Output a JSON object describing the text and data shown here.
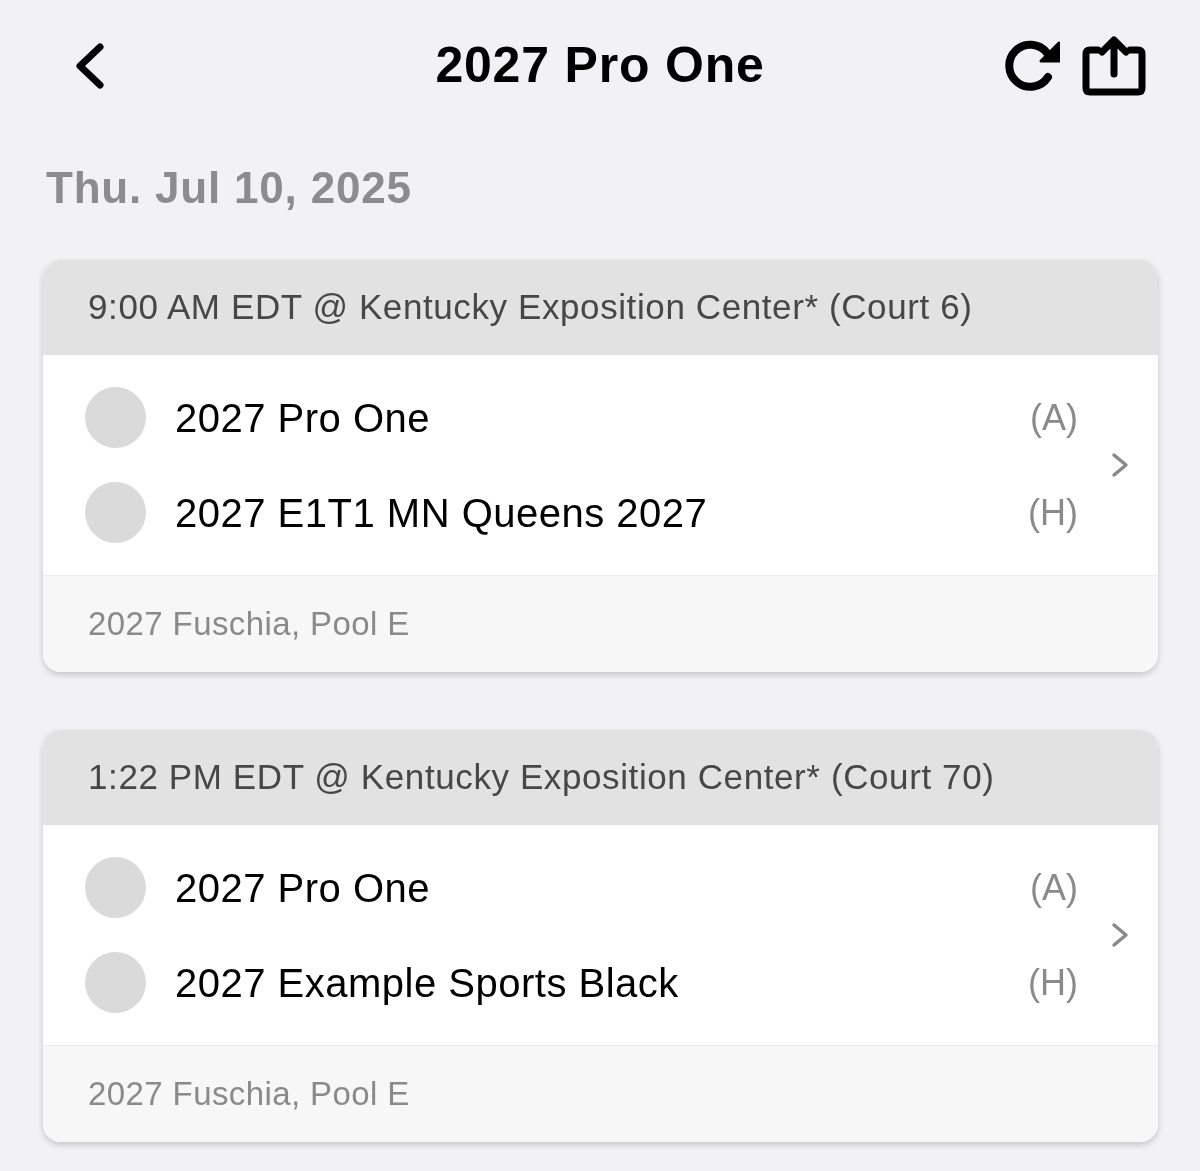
{
  "header": {
    "title": "2027 Pro One"
  },
  "date": "Thu. Jul 10, 2025",
  "games": [
    {
      "heading": "9:00 AM EDT @ Kentucky Exposition Center* (Court 6)",
      "teams": [
        {
          "name": "2027 Pro One",
          "side": "(A)"
        },
        {
          "name": "2027 E1T1 MN Queens 2027",
          "side": "(H)"
        }
      ],
      "pool": "2027 Fuschia, Pool E"
    },
    {
      "heading": "1:22 PM EDT @ Kentucky Exposition Center* (Court 70)",
      "teams": [
        {
          "name": "2027 Pro One",
          "side": "(A)"
        },
        {
          "name": "2027 Example Sports Black",
          "side": "(H)"
        }
      ],
      "pool": "2027 Fuschia, Pool E"
    }
  ]
}
